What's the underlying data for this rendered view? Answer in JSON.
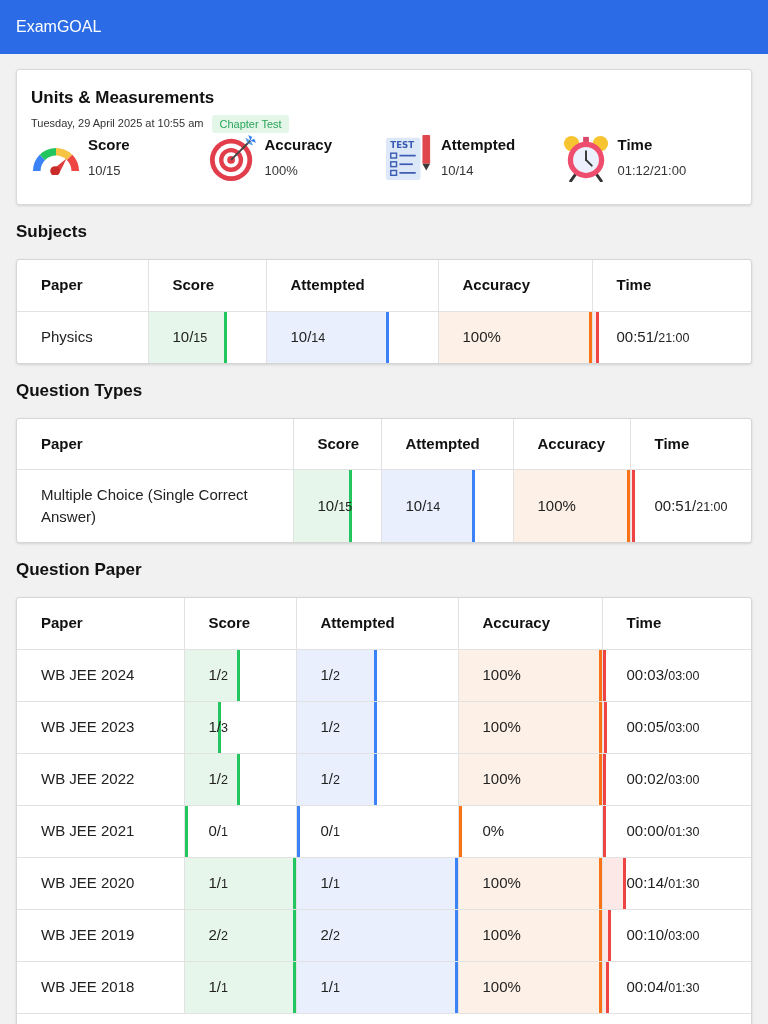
{
  "header": {
    "title": "ExamGOAL"
  },
  "summary": {
    "title": "Units & Measurements",
    "date": "Tuesday, 29 April 2025 at 10:55 am",
    "tag": "Chapter Test",
    "stats": [
      {
        "kind": "score",
        "label": "Score",
        "value": "10/15"
      },
      {
        "kind": "accuracy",
        "label": "Accuracy",
        "value": "100%"
      },
      {
        "kind": "attempted",
        "label": "Attempted",
        "value": "10/14",
        "icon_text": "TEST"
      },
      {
        "kind": "time",
        "label": "Time",
        "value": "01:12/21:00"
      }
    ]
  },
  "sections": [
    {
      "title": "Subjects",
      "columns": [
        "Paper",
        "Score",
        "Attempted",
        "Accuracy",
        "Time"
      ],
      "rows": [
        {
          "cells": [
            {
              "kind": "label",
              "value": "Physics"
            },
            {
              "kind": "meter",
              "value": "10/",
              "total": "15",
              "level": 0.667
            },
            {
              "kind": "meter",
              "value": "10/",
              "total": "14",
              "level": 0.714
            },
            {
              "kind": "meter",
              "value": "100%",
              "level": 1
            },
            {
              "kind": "meter",
              "value": "00:51/",
              "total": "21:00",
              "level": 0.04
            }
          ]
        }
      ]
    },
    {
      "title": "Question Types",
      "columns": [
        "Paper",
        "Score",
        "Attempted",
        "Accuracy",
        "Time"
      ],
      "rows": [
        {
          "cells": [
            {
              "kind": "label",
              "value": "Multiple Choice (Single Correct Answer)"
            },
            {
              "kind": "meter",
              "value": "10/",
              "total": "15",
              "level": 0.667
            },
            {
              "kind": "meter",
              "value": "10/",
              "total": "14",
              "level": 0.714
            },
            {
              "kind": "meter",
              "value": "100%",
              "level": 1
            },
            {
              "kind": "meter",
              "value": "00:51/",
              "total": "21:00",
              "level": 0.04
            }
          ]
        }
      ]
    },
    {
      "title": "Question Paper",
      "columns": [
        "Paper",
        "Score",
        "Attempted",
        "Accuracy",
        "Time"
      ],
      "rows": [
        {
          "cells": [
            {
              "kind": "label",
              "value": "WB JEE 2024"
            },
            {
              "kind": "meter",
              "value": "1/",
              "total": "2",
              "level": 0.5
            },
            {
              "kind": "meter",
              "value": "1/",
              "total": "2",
              "level": 0.5
            },
            {
              "kind": "meter",
              "value": "100%",
              "level": 1
            },
            {
              "kind": "meter",
              "value": "00:03/",
              "total": "03:00",
              "level": 0.017
            }
          ]
        },
        {
          "cells": [
            {
              "kind": "label",
              "value": "WB JEE 2023"
            },
            {
              "kind": "meter",
              "value": "1/",
              "total": "3",
              "level": 0.333
            },
            {
              "kind": "meter",
              "value": "1/",
              "total": "2",
              "level": 0.5
            },
            {
              "kind": "meter",
              "value": "100%",
              "level": 1
            },
            {
              "kind": "meter",
              "value": "00:05/",
              "total": "03:00",
              "level": 0.028
            }
          ]
        },
        {
          "cells": [
            {
              "kind": "label",
              "value": "WB JEE 2022"
            },
            {
              "kind": "meter",
              "value": "1/",
              "total": "2",
              "level": 0.5
            },
            {
              "kind": "meter",
              "value": "1/",
              "total": "2",
              "level": 0.5
            },
            {
              "kind": "meter",
              "value": "100%",
              "level": 1
            },
            {
              "kind": "meter",
              "value": "00:02/",
              "total": "03:00",
              "level": 0.011
            }
          ]
        },
        {
          "cells": [
            {
              "kind": "label",
              "value": "WB JEE 2021"
            },
            {
              "kind": "meter",
              "value": "0/",
              "total": "1",
              "level": 0
            },
            {
              "kind": "meter",
              "value": "0/",
              "total": "1",
              "level": 0
            },
            {
              "kind": "meter",
              "value": "0%",
              "level": 0
            },
            {
              "kind": "meter",
              "value": "00:00/",
              "total": "01:30",
              "level": 0
            }
          ]
        },
        {
          "cells": [
            {
              "kind": "label",
              "value": "WB JEE 2020"
            },
            {
              "kind": "meter",
              "value": "1/",
              "total": "1",
              "level": 1
            },
            {
              "kind": "meter",
              "value": "1/",
              "total": "1",
              "level": 1
            },
            {
              "kind": "meter",
              "value": "100%",
              "level": 1
            },
            {
              "kind": "meter",
              "value": "00:14/",
              "total": "01:30",
              "level": 0.156
            }
          ]
        },
        {
          "cells": [
            {
              "kind": "label",
              "value": "WB JEE 2019"
            },
            {
              "kind": "meter",
              "value": "2/",
              "total": "2",
              "level": 1
            },
            {
              "kind": "meter",
              "value": "2/",
              "total": "2",
              "level": 1
            },
            {
              "kind": "meter",
              "value": "100%",
              "level": 1
            },
            {
              "kind": "meter",
              "value": "00:10/",
              "total": "03:00",
              "level": 0.056
            }
          ]
        },
        {
          "cells": [
            {
              "kind": "label",
              "value": "WB JEE 2018"
            },
            {
              "kind": "meter",
              "value": "1/",
              "total": "1",
              "level": 1
            },
            {
              "kind": "meter",
              "value": "1/",
              "total": "1",
              "level": 1
            },
            {
              "kind": "meter",
              "value": "100%",
              "level": 1
            },
            {
              "kind": "meter",
              "value": "00:04/",
              "total": "01:30",
              "level": 0.044
            }
          ]
        }
      ]
    }
  ]
}
